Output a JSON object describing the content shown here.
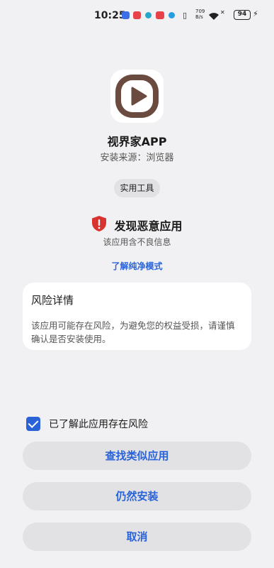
{
  "status_bar": {
    "time": "10:25",
    "net_speed_value": "709",
    "net_speed_unit": "B/s",
    "battery": "94"
  },
  "app": {
    "name": "视界家APP",
    "source": "安装来源：浏览器",
    "tag": "实用工具",
    "icon": "play-icon"
  },
  "warning": {
    "title": "发现恶意应用",
    "subtitle": "该应用含不良信息",
    "link": "了解纯净模式",
    "icon": "shield-warning-icon",
    "color": "#d8332e"
  },
  "risk": {
    "title": "风险详情",
    "body": "该应用可能存在风险，为避免您的权益受损，请谨慎确认是否安装使用。"
  },
  "consent": {
    "label": "已了解此应用存在风险",
    "checked": true
  },
  "buttons": {
    "find_similar": "查找类似应用",
    "install_anyway": "仍然安装",
    "cancel": "取消"
  },
  "colors": {
    "accent": "#2a63d8",
    "background": "#f1f1f3",
    "icon_brown": "#6b4a3f"
  }
}
